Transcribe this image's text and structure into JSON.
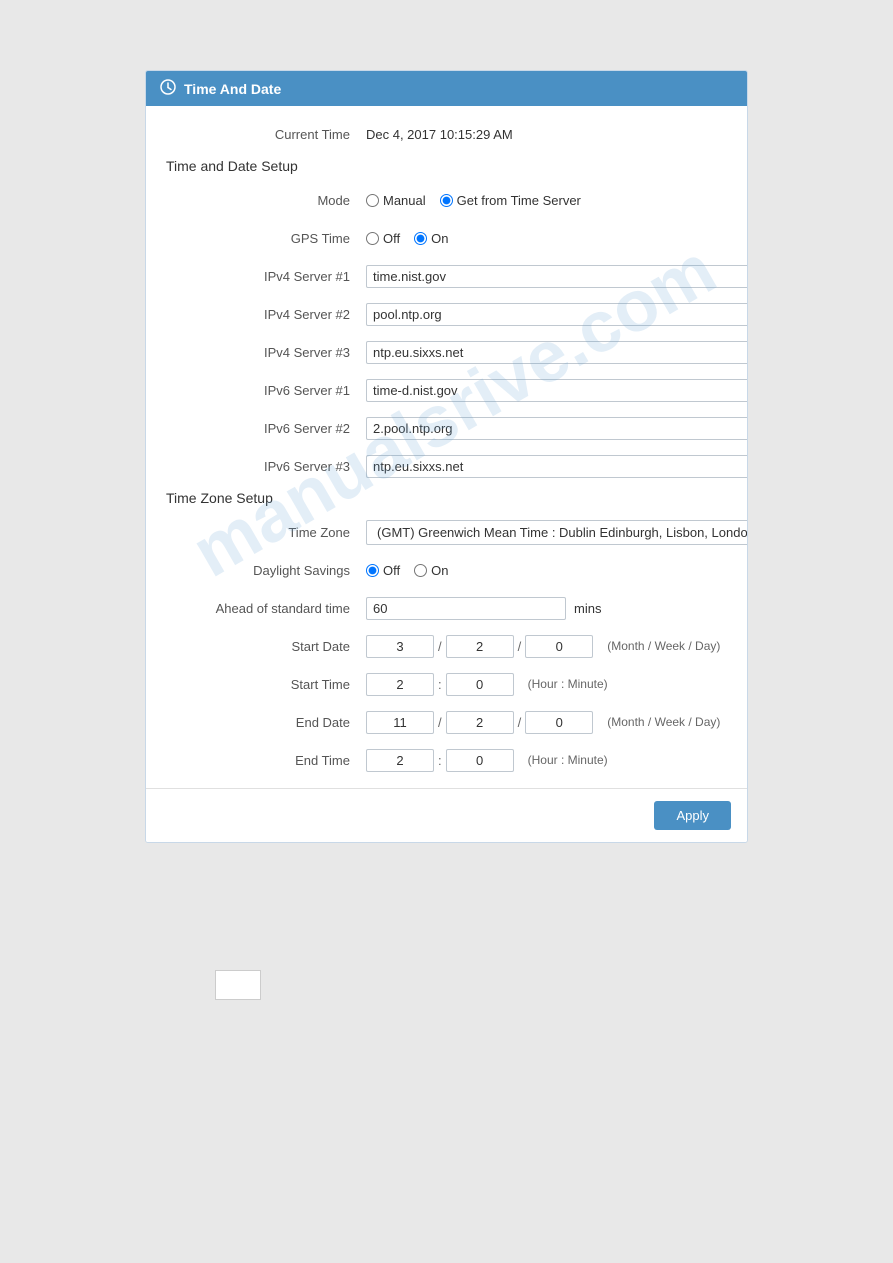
{
  "header": {
    "icon": "clock",
    "title": "Time And Date"
  },
  "current_time_label": "Current Time",
  "current_time_value": "Dec 4, 2017 10:15:29 AM",
  "section_time_date": "Time and Date Setup",
  "section_timezone": "Time Zone Setup",
  "fields": {
    "mode_label": "Mode",
    "mode_manual": "Manual",
    "mode_server": "Get from Time Server",
    "mode_selected": "server",
    "gps_time_label": "GPS Time",
    "gps_off": "Off",
    "gps_on": "On",
    "gps_selected": "on",
    "ipv4_server1_label": "IPv4 Server #1",
    "ipv4_server1_value": "time.nist.gov",
    "ipv4_server2_label": "IPv4 Server #2",
    "ipv4_server2_value": "pool.ntp.org",
    "ipv4_server3_label": "IPv4 Server #3",
    "ipv4_server3_value": "ntp.eu.sixxs.net",
    "ipv6_server1_label": "IPv6 Server #1",
    "ipv6_server1_value": "time-d.nist.gov",
    "ipv6_server2_label": "IPv6 Server #2",
    "ipv6_server2_value": "2.pool.ntp.org",
    "ipv6_server3_label": "IPv6 Server #3",
    "ipv6_server3_value": "ntp.eu.sixxs.net",
    "timezone_label": "Time Zone",
    "timezone_value": "(GMT) Greenwich Mean Time : Dublin Edinburgh, Lisbon, London",
    "daylight_savings_label": "Daylight Savings",
    "daylight_off": "Off",
    "daylight_on": "On",
    "daylight_selected": "off",
    "ahead_label": "Ahead of standard time",
    "ahead_value": "60",
    "ahead_unit": "mins",
    "start_date_label": "Start Date",
    "start_date_month": "3",
    "start_date_week": "2",
    "start_date_day": "0",
    "start_date_hint": "(Month / Week / Day)",
    "start_time_label": "Start Time",
    "start_time_hour": "2",
    "start_time_minute": "0",
    "start_time_hint": "(Hour : Minute)",
    "end_date_label": "End Date",
    "end_date_month": "11",
    "end_date_week": "2",
    "end_date_day": "0",
    "end_date_hint": "(Month / Week / Day)",
    "end_time_label": "End Time",
    "end_time_hour": "2",
    "end_time_minute": "0",
    "end_time_hint": "(Hour : Minute)"
  },
  "footer": {
    "apply_label": "Apply"
  }
}
